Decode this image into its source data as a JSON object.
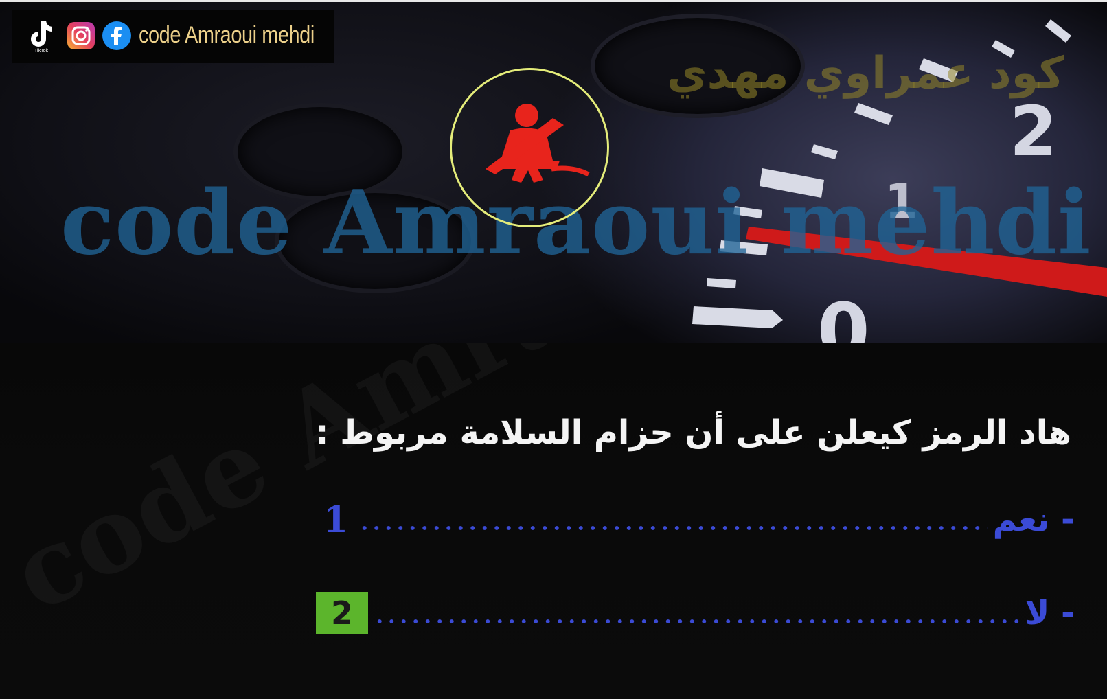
{
  "header": {
    "brand_handle": "code Amraoui mehdi",
    "icons": [
      "tiktok-icon",
      "instagram-icon",
      "facebook-icon"
    ],
    "tiktok_caption": "TikTok"
  },
  "photo": {
    "watermark_latin": "code Amraoui mehdi",
    "watermark_arabic": "كود عمراوي مهدي",
    "gauge_numbers": [
      "2",
      "1",
      "0"
    ],
    "warning_light": "seatbelt-warning-icon",
    "warning_light_color": "#e8241c",
    "highlight_ring_color": "#e4ec7a"
  },
  "quiz": {
    "question": "هاد الرمز كيعلن على أن حزام السلامة مربوط :",
    "answers": [
      {
        "label": "- نعم",
        "number": "1",
        "selected": false
      },
      {
        "label": "- لا",
        "number": "2",
        "selected": true
      }
    ],
    "answer_color": "#3b4bd6",
    "selected_color": "#5cb52c"
  },
  "panel_watermark": "code Amraoui"
}
